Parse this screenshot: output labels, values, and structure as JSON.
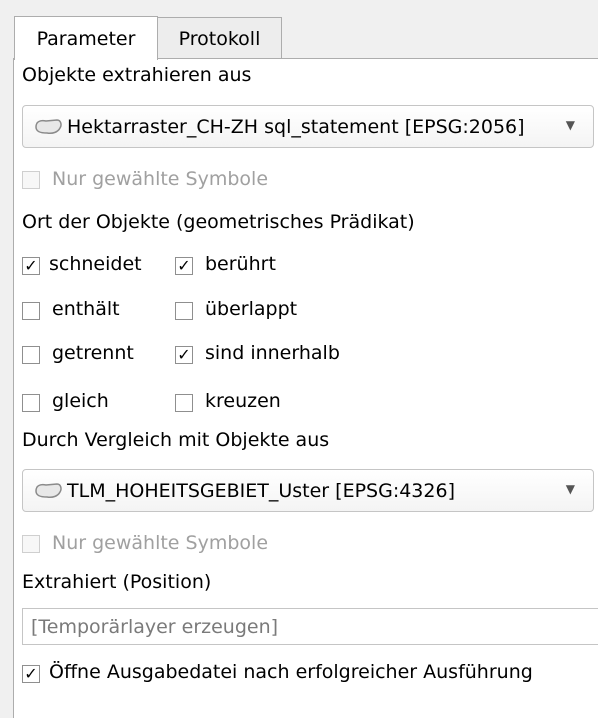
{
  "tabs": [
    {
      "label": "Parameter",
      "active": true
    },
    {
      "label": "Protokoll",
      "active": false
    }
  ],
  "input_layer": {
    "label": "Objekte extrahieren aus",
    "value": "Hektarraster_CH-ZH sql_statement [EPSG:2056]",
    "icon": "polygon-layer-icon",
    "selected_only": {
      "label": "Nur gewählte Symbole",
      "checked": false,
      "enabled": false
    }
  },
  "predicate": {
    "label": "Ort der Objekte (geometrisches Prädikat)",
    "options": [
      {
        "label": "schneidet",
        "checked": true
      },
      {
        "label": "berührt",
        "checked": true
      },
      {
        "label": "enthält",
        "checked": false
      },
      {
        "label": "überlappt",
        "checked": false
      },
      {
        "label": "getrennt",
        "checked": false
      },
      {
        "label": "sind innerhalb",
        "checked": true
      },
      {
        "label": "gleich",
        "checked": false
      },
      {
        "label": "kreuzen",
        "checked": false
      }
    ]
  },
  "compare_layer": {
    "label": "Durch Vergleich mit Objekte aus",
    "value": "TLM_HOHEITSGEBIET_Uster [EPSG:4326]",
    "icon": "polygon-layer-icon",
    "selected_only": {
      "label": "Nur gewählte Symbole",
      "checked": false,
      "enabled": false
    }
  },
  "output": {
    "label": "Extrahiert (Position)",
    "placeholder": "[Temporärlayer erzeugen]",
    "open_after": {
      "label": "Öffne Ausgabedatei nach erfolgreicher Ausführung",
      "checked": true
    }
  },
  "check_glyph": "✓"
}
